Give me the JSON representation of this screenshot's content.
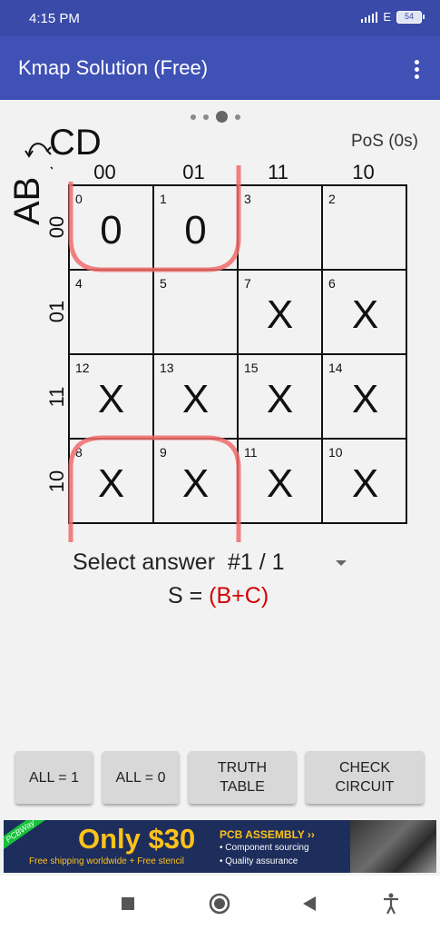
{
  "status_bar": {
    "time": "4:15 PM",
    "network": "E",
    "battery": "54"
  },
  "app_bar": {
    "title": "Kmap Solution (Free)",
    "menu_icon": "more-vert-icon"
  },
  "page_indicator": {
    "count": 4,
    "active_index": 2
  },
  "kmap": {
    "mode_label": "PoS (0s)",
    "col_var": "CD",
    "row_var": "AB",
    "col_headers": [
      "00",
      "01",
      "11",
      "10"
    ],
    "row_headers": [
      "00",
      "01",
      "11",
      "10"
    ],
    "rows": [
      [
        {
          "index": "0",
          "value": "0"
        },
        {
          "index": "1",
          "value": "0"
        },
        {
          "index": "3",
          "value": ""
        },
        {
          "index": "2",
          "value": ""
        }
      ],
      [
        {
          "index": "4",
          "value": ""
        },
        {
          "index": "5",
          "value": ""
        },
        {
          "index": "7",
          "value": "X"
        },
        {
          "index": "6",
          "value": "X"
        }
      ],
      [
        {
          "index": "12",
          "value": "X"
        },
        {
          "index": "13",
          "value": "X"
        },
        {
          "index": "15",
          "value": "X"
        },
        {
          "index": "14",
          "value": "X"
        }
      ],
      [
        {
          "index": "8",
          "value": "X"
        },
        {
          "index": "9",
          "value": "X"
        },
        {
          "index": "11",
          "value": "X"
        },
        {
          "index": "10",
          "value": "X"
        }
      ]
    ],
    "group_color": "#f26b6b"
  },
  "answer": {
    "select_label": "Select answer",
    "selected": "#1 / 1"
  },
  "solution": {
    "prefix": "S = ",
    "expression": "(B+C)",
    "expression_color": "#d40000"
  },
  "buttons": {
    "all_one": "ALL = 1",
    "all_zero": "ALL = 0",
    "truth_table": "TRUTH\nTABLE",
    "check_circuit": "CHECK\nCIRCUIT"
  },
  "ad": {
    "brand": "PCBWay",
    "headline": "Only $30",
    "subline": "Free shipping worldwide + Free stencil",
    "title": "PCB ASSEMBLY ››",
    "line1": "• Component sourcing",
    "line2": "• Quality assurance"
  },
  "nav_bar": {
    "items": [
      "recents-square-icon",
      "home-circle-icon",
      "back-triangle-icon",
      "accessibility-icon"
    ]
  }
}
